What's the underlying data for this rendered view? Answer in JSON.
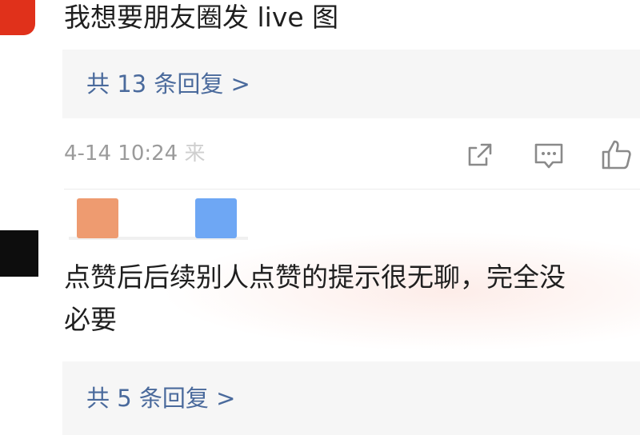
{
  "comments": [
    {
      "text": "我想要朋友圈发 live 图",
      "reply_count_label": "共 13 条回复 >",
      "timestamp": "4-14 10:24",
      "source_partial": "来",
      "actions": [
        "share-icon",
        "comment-icon",
        "like-icon"
      ]
    },
    {
      "text_line1": "点赞后后续别人点赞的提示很无聊，完全没",
      "text_line2": "必要",
      "reply_count_label": "共 5 条回复 >"
    }
  ],
  "colors": {
    "reply_link": "#4a6a9c",
    "meta_text": "#9b9b9b",
    "avatar_1": "#e0311b",
    "avatar_2": "#0d0d0d"
  }
}
